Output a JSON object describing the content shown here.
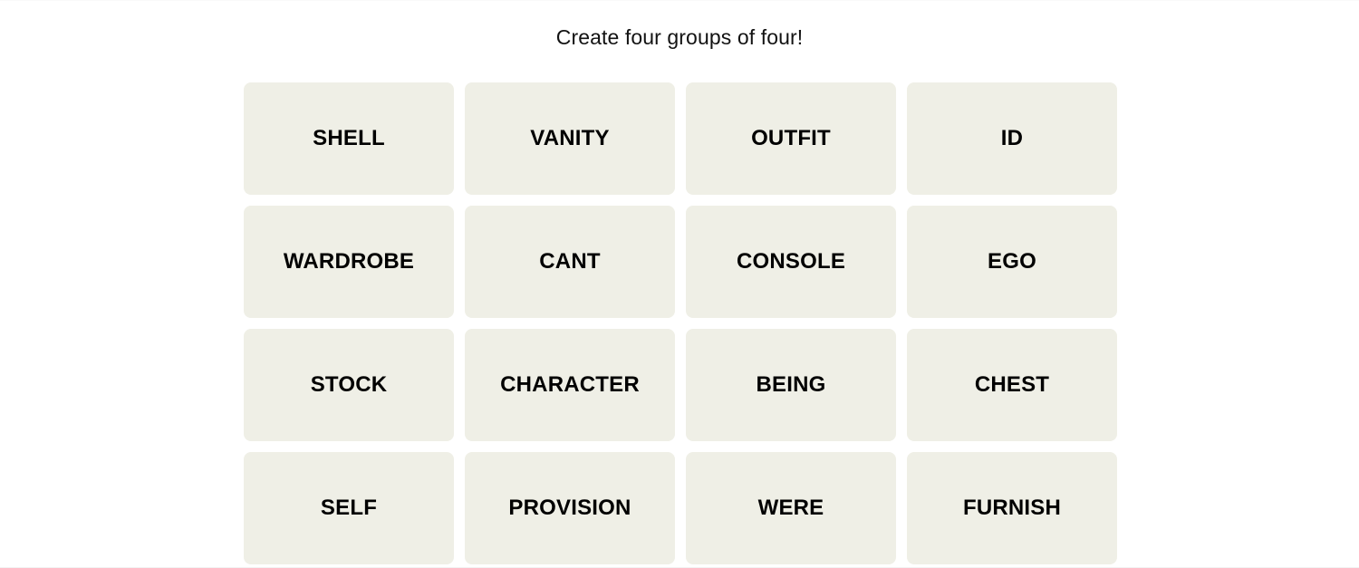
{
  "page": {
    "background_color": "#ffffff",
    "instruction": "Create four groups of four!"
  },
  "board": {
    "rows": 4,
    "columns": 4,
    "tile_color": "#efefe6",
    "tile_text_color": "#000000",
    "tiles": [
      {
        "label": "SHELL"
      },
      {
        "label": "VANITY"
      },
      {
        "label": "OUTFIT"
      },
      {
        "label": "ID"
      },
      {
        "label": "WARDROBE"
      },
      {
        "label": "CANT"
      },
      {
        "label": "CONSOLE"
      },
      {
        "label": "EGO"
      },
      {
        "label": "STOCK"
      },
      {
        "label": "CHARACTER"
      },
      {
        "label": "BEING"
      },
      {
        "label": "CHEST"
      },
      {
        "label": "SELF"
      },
      {
        "label": "PROVISION"
      },
      {
        "label": "WERE"
      },
      {
        "label": "FURNISH"
      }
    ]
  }
}
